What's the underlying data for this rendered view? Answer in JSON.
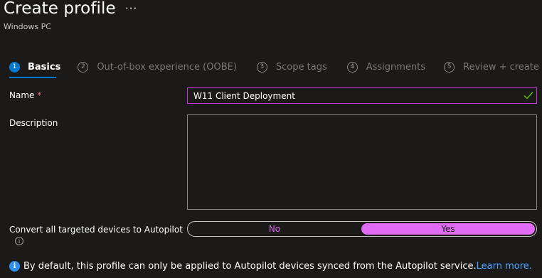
{
  "header": {
    "title": "Create profile",
    "more_glyph": "···",
    "subtitle": "Windows PC"
  },
  "steps": [
    {
      "num": "1",
      "label": "Basics",
      "active": true
    },
    {
      "num": "2",
      "label": "Out-of-box experience (OOBE)",
      "active": false
    },
    {
      "num": "3",
      "label": "Scope tags",
      "active": false
    },
    {
      "num": "4",
      "label": "Assignments",
      "active": false
    },
    {
      "num": "5",
      "label": "Review + create",
      "active": false
    }
  ],
  "form": {
    "name_label": "Name",
    "required_mark": "*",
    "name_value": "W11 Client Deployment",
    "description_label": "Description",
    "description_value": "",
    "convert_label": "Convert all targeted devices to Autopilot",
    "toggle_no": "No",
    "toggle_yes": "Yes",
    "toggle_selected": "Yes",
    "info_glyph": "i"
  },
  "info_bar": {
    "text": "By default, this profile can only be applied to Autopilot devices synced from the Autopilot service.",
    "link": "Learn more.",
    "icon": "info-icon"
  },
  "colors": {
    "accent": "#0078d4",
    "toggle_selected": "#e06cf5",
    "valid_border": "#c239d6",
    "link": "#4da3ff",
    "check": "#6bb700"
  }
}
